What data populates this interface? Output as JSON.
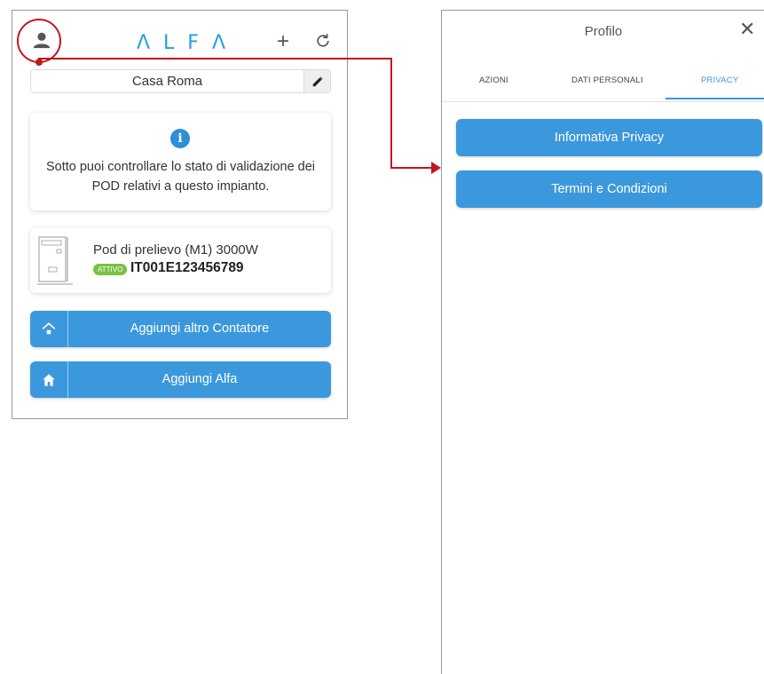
{
  "left_screen": {
    "logo_letters": [
      "Λ",
      "L",
      "F",
      "Λ"
    ],
    "house_name": "Casa Roma",
    "info_text": "Sotto puoi controllare lo stato di validazione dei POD relativi a questo impianto.",
    "pod": {
      "title": "Pod di prelievo (M1) 3000W",
      "badge": "ATTIVO",
      "code": "IT001E123456789"
    },
    "buttons": {
      "add_meter": "Aggiungi altro Contatore",
      "add_alfa": "Aggiungi Alfa"
    }
  },
  "right_screen": {
    "title": "Profilo",
    "tabs": [
      {
        "label": "AZIONI"
      },
      {
        "label": "DATI PERSONALI"
      },
      {
        "label": "PRIVACY"
      }
    ],
    "buttons": {
      "privacy_policy": "Informativa Privacy",
      "terms": "Termini e Condizioni"
    }
  },
  "colors": {
    "accent": "#3b98dd",
    "logo": "#1ea0dc",
    "badge": "#7cc143",
    "annotation": "#c0181c"
  }
}
